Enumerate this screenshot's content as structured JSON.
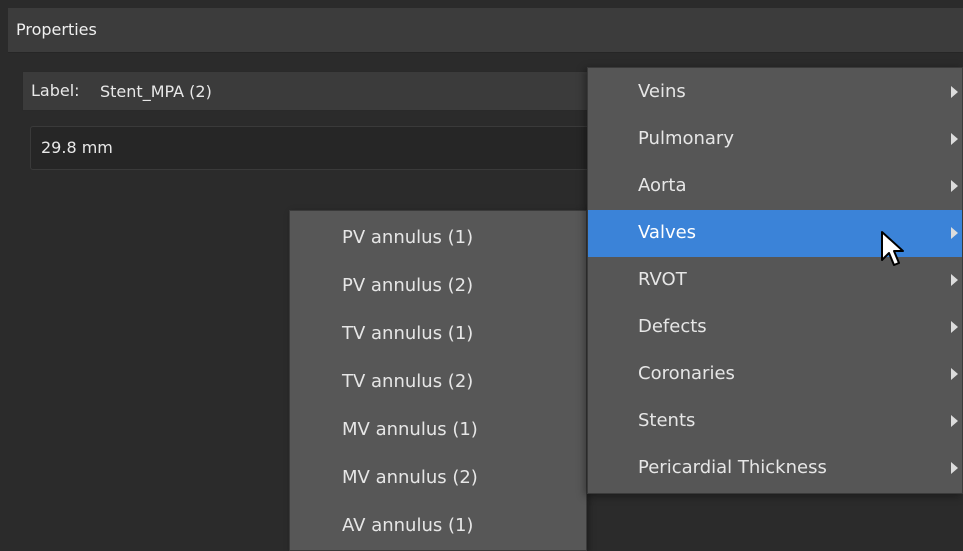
{
  "panel": {
    "title": "Properties"
  },
  "label_field": {
    "prefix": "Label:",
    "value": "Stent_MPA (2)"
  },
  "measurement": {
    "value": "29.8 mm"
  },
  "main_menu": {
    "items": [
      {
        "label": "Veins",
        "has_submenu": true,
        "active": false
      },
      {
        "label": "Pulmonary",
        "has_submenu": true,
        "active": false
      },
      {
        "label": "Aorta",
        "has_submenu": true,
        "active": false
      },
      {
        "label": "Valves",
        "has_submenu": true,
        "active": true
      },
      {
        "label": "RVOT",
        "has_submenu": true,
        "active": false
      },
      {
        "label": "Defects",
        "has_submenu": true,
        "active": false
      },
      {
        "label": "Coronaries",
        "has_submenu": true,
        "active": false
      },
      {
        "label": "Stents",
        "has_submenu": true,
        "active": false
      },
      {
        "label": "Pericardial Thickness",
        "has_submenu": true,
        "active": false
      }
    ]
  },
  "submenu": {
    "items": [
      {
        "label": "PV annulus (1)"
      },
      {
        "label": "PV annulus (2)"
      },
      {
        "label": "TV annulus (1)"
      },
      {
        "label": "TV annulus (2)"
      },
      {
        "label": "MV annulus (1)"
      },
      {
        "label": "MV annulus (2)"
      },
      {
        "label": "AV annulus (1)"
      }
    ]
  },
  "colors": {
    "highlight": "#3b83d8",
    "menu_bg": "#565656",
    "panel_bg": "#2b2b2b"
  },
  "icons": {
    "submenu_arrow": "triangle-right-icon",
    "cursor": "mouse-pointer-icon"
  }
}
